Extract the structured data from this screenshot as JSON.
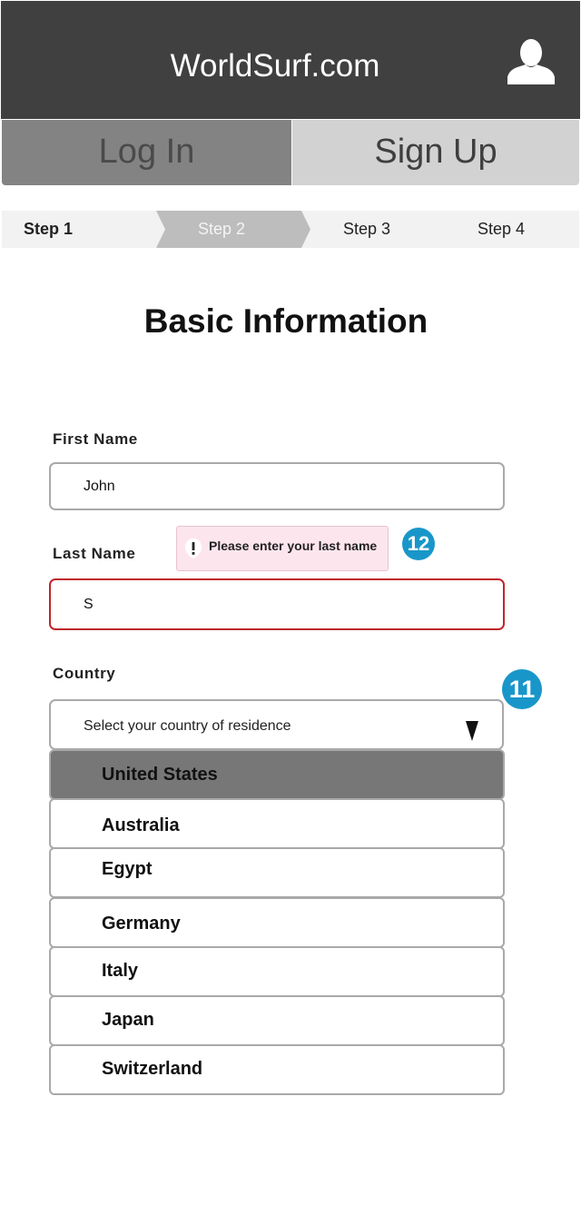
{
  "app": {
    "title": "WorldSurf.com"
  },
  "header": {
    "user_icon": "user-silhouette-icon"
  },
  "auth_tabs": [
    {
      "label": "Log In"
    },
    {
      "label": "Sign Up"
    }
  ],
  "steps": [
    {
      "label": "Step 1"
    },
    {
      "label": "Step 2"
    },
    {
      "label": "Step 3"
    },
    {
      "label": "Step 4"
    }
  ],
  "active_step": "Step 2",
  "page_title": "Basic Information",
  "form": {
    "first_name": {
      "label": "First Name",
      "value": "John"
    },
    "last_name": {
      "label": "Last Name",
      "value": "S",
      "error": "Please enter your last name"
    },
    "country": {
      "label": "Country",
      "placeholder": "Select your country of residence",
      "options": [
        "United States",
        "Australia",
        "Egypt",
        "Germany",
        "Italy",
        "Japan",
        "Switzerland"
      ],
      "highlighted": "United States"
    }
  },
  "annotations": {
    "badge_last_name": "12",
    "badge_country": "11"
  },
  "colors": {
    "accent": "#1996c9",
    "error": "#c0262c",
    "header": "#404040"
  }
}
